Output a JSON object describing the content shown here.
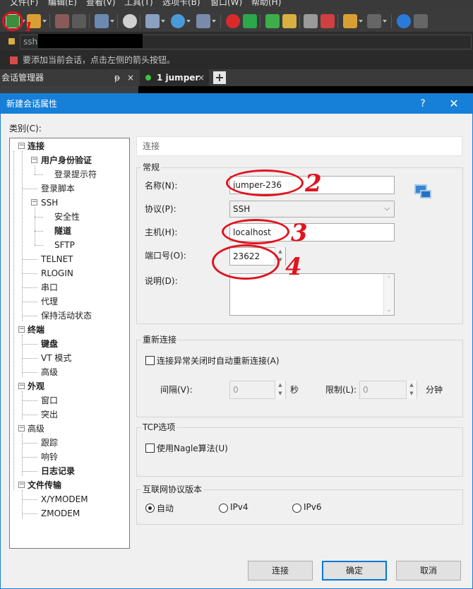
{
  "menu": [
    "文件(F)",
    "编辑(E)",
    "查看(V)",
    "工具(T)",
    "选项卡(B)",
    "窗口(W)",
    "帮助(H)"
  ],
  "address": {
    "value": "ssh:"
  },
  "hint_text": "要添加当前会话，点击左侧的箭头按钮。",
  "session_panel": {
    "title": "会话管理器",
    "pin": "ᵽ",
    "close": "×"
  },
  "tabs": [
    {
      "label": "1 jumper",
      "close": "×"
    }
  ],
  "tab_add": "+",
  "dialog": {
    "title": "新建会话属性",
    "help": "?",
    "close": "✕",
    "category_label": "类别(C):",
    "tree": [
      {
        "label": "连接",
        "bold": true
      },
      {
        "label": "用户身份验证",
        "bold": true
      },
      {
        "label": "登录提示符",
        "bold": false
      },
      {
        "label": "登录脚本",
        "bold": false
      },
      {
        "label": "SSH",
        "bold": false
      },
      {
        "label": "安全性",
        "bold": false
      },
      {
        "label": "隧道",
        "bold": true
      },
      {
        "label": "SFTP",
        "bold": false
      },
      {
        "label": "TELNET",
        "bold": false
      },
      {
        "label": "RLOGIN",
        "bold": false
      },
      {
        "label": "串口",
        "bold": false
      },
      {
        "label": "代理",
        "bold": false
      },
      {
        "label": "保持活动状态",
        "bold": false
      },
      {
        "label": "终端",
        "bold": true
      },
      {
        "label": "键盘",
        "bold": true
      },
      {
        "label": "VT 模式",
        "bold": false
      },
      {
        "label": "高级",
        "bold": false
      },
      {
        "label": "外观",
        "bold": true
      },
      {
        "label": "窗口",
        "bold": false
      },
      {
        "label": "突出",
        "bold": false
      },
      {
        "label": "高级",
        "bold": false
      },
      {
        "label": "跟踪",
        "bold": false
      },
      {
        "label": "响铃",
        "bold": false
      },
      {
        "label": "日志记录",
        "bold": true
      },
      {
        "label": "文件传输",
        "bold": true
      },
      {
        "label": "X/YMODEM",
        "bold": false
      },
      {
        "label": "ZMODEM",
        "bold": false
      }
    ],
    "breadcrumb": "连接",
    "general": {
      "title": "常规",
      "name_label": "名称(N):",
      "name_value": "jumper-236",
      "protocol_label": "协议(P):",
      "protocol_value": "SSH",
      "host_label": "主机(H):",
      "host_value": "localhost",
      "port_label": "端口号(O):",
      "port_value": "23622",
      "desc_label": "说明(D):"
    },
    "reconnect": {
      "title": "重新连接",
      "checkbox_label": "连接异常关闭时自动重新连接(A)",
      "interval_label": "间隔(V):",
      "interval_value": "0",
      "interval_unit": "秒",
      "limit_label": "限制(L):",
      "limit_value": "0",
      "limit_unit": "分钟"
    },
    "tcp": {
      "title": "TCP选项",
      "nagle_label": "使用Nagle算法(U)"
    },
    "ipver": {
      "title": "互联网协议版本",
      "options": [
        "自动",
        "IPv4",
        "IPv6"
      ],
      "selected": "自动"
    },
    "buttons": {
      "connect": "连接",
      "ok": "确定",
      "cancel": "取消"
    }
  },
  "annotations": [
    "1",
    "2",
    "3",
    "4"
  ]
}
